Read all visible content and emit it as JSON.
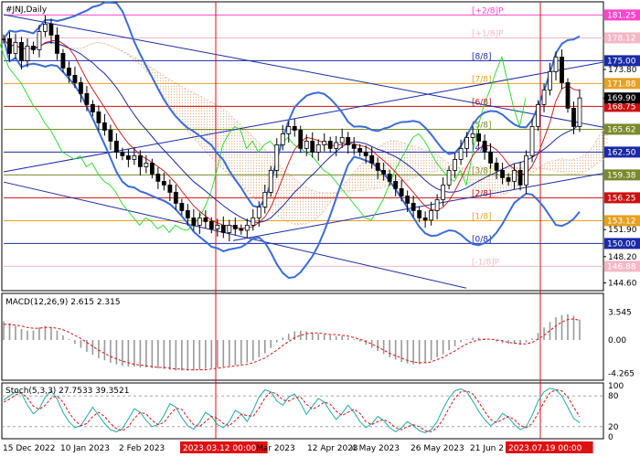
{
  "chart_data": {
    "type": "line",
    "symbol_title": "#JNJ,Daily",
    "x_labels": [
      "15 Dec 2022",
      "10 Jan 2023",
      "2 Feb 2023",
      "2023.03.12 00:00",
      "Mar 2023",
      "12 Apr 2023",
      "4 May 2023",
      "26 May 2023",
      "21 Jun 2",
      "2023.07.19 00:00"
    ],
    "price_axis": {
      "ylim": [
        143.8,
        182.8
      ],
      "ticks": [
        "173.80",
        "169.90",
        "165.62",
        "162.50",
        "159.38",
        "156.25",
        "153.12",
        "151.90",
        "150.00",
        "148.20",
        "146.88",
        "144.60"
      ]
    },
    "murrey_levels": [
      {
        "label": "[+2/8]P",
        "value": 181.25,
        "color": "#ff44cc"
      },
      {
        "label": "[+1/8]P",
        "value": 178.12,
        "color": "#f4b8c4"
      },
      {
        "label": "[8/8]",
        "value": 175.0,
        "color": "#1a2aa8"
      },
      {
        "label": "[7/8]",
        "value": 171.88,
        "color": "#e8a020"
      },
      {
        "label": "[6/8]",
        "value": 168.75,
        "color": "#cc1010"
      },
      {
        "label": "[5/8]",
        "value": 165.62,
        "color": "#7a8a2a"
      },
      {
        "label": "[4/8]",
        "value": 162.5,
        "color": "#1a2aa8"
      },
      {
        "label": "[3/8]",
        "value": 159.38,
        "color": "#7a8a2a"
      },
      {
        "label": "[2/8]",
        "value": 156.25,
        "color": "#cc1010"
      },
      {
        "label": "[1/8]",
        "value": 153.12,
        "color": "#e8a020"
      },
      {
        "label": "[0/8]",
        "value": 150.0,
        "color": "#1a2aa8"
      },
      {
        "label": "[-1/8]P",
        "value": 146.88,
        "color": "#f4b8c4"
      }
    ],
    "level_tags": [
      "181.25",
      "178.12",
      "175.00",
      "171.88",
      "168.75",
      "165.62",
      "162.50",
      "159.38",
      "156.25",
      "153.12",
      "150.00",
      "146.88"
    ],
    "last_price": "169.90",
    "price_series": [
      178,
      176,
      177.5,
      175,
      177,
      176.5,
      179,
      180,
      178.5,
      176,
      174,
      173,
      172,
      170.5,
      169,
      168,
      166.5,
      165.5,
      164,
      162.5,
      162,
      161.5,
      162,
      160.5,
      161,
      159.5,
      158.5,
      158,
      157,
      155.5,
      154.5,
      153.5,
      152.5,
      153.5,
      153,
      152,
      152.5,
      151.5,
      152.5,
      152,
      151.8,
      152.5,
      153.5,
      155,
      157,
      160,
      163.5,
      165,
      166,
      165.5,
      163,
      164,
      162.5,
      163.5,
      164,
      163,
      163.8,
      164.5,
      163.5,
      163,
      162.5,
      162,
      161,
      160,
      159.5,
      158.5,
      157.5,
      156.5,
      155.5,
      154.5,
      153.5,
      153.2,
      154.5,
      156,
      158,
      160,
      161.5,
      163,
      164.5,
      165,
      164,
      162.5,
      161,
      160,
      159,
      158.5,
      160,
      158,
      162,
      166,
      169,
      171,
      173.5,
      175.5,
      172,
      168.5,
      166,
      169.9
    ],
    "macd": {
      "label": "MACD(12,26,9) 2.615 2.315",
      "ticks": [
        "3.545",
        "0.00",
        "-4.265"
      ],
      "range": [
        -4.9,
        4.2
      ],
      "histogram": [
        2.4,
        2.1,
        1.8,
        1.4,
        1.2,
        1.2,
        1.6,
        1.8,
        1.6,
        1.2,
        0.6,
        0.1,
        -0.5,
        -1.0,
        -1.5,
        -1.9,
        -2.3,
        -2.6,
        -2.9,
        -3.1,
        -3.3,
        -3.4,
        -3.4,
        -3.5,
        -3.5,
        -3.6,
        -3.6,
        -3.7,
        -3.8,
        -3.9,
        -3.9,
        -3.9,
        -3.9,
        -3.8,
        -3.7,
        -3.6,
        -3.5,
        -3.4,
        -3.3,
        -3.2,
        -3.1,
        -2.9,
        -2.6,
        -2.2,
        -1.7,
        -1.0,
        -0.3,
        0.3,
        0.8,
        1.1,
        1.2,
        1.1,
        0.9,
        0.8,
        0.7,
        0.6,
        0.5,
        0.5,
        0.3,
        0.1,
        -0.2,
        -0.6,
        -1.0,
        -1.4,
        -1.8,
        -2.2,
        -2.5,
        -2.8,
        -3.0,
        -3.1,
        -3.1,
        -2.9,
        -2.6,
        -2.2,
        -1.8,
        -1.3,
        -0.8,
        -0.3,
        0.1,
        0.3,
        0.3,
        0.2,
        0.0,
        -0.2,
        -0.4,
        -0.5,
        -0.5,
        -0.6,
        -0.3,
        0.2,
        0.9,
        1.6,
        2.3,
        2.9,
        3.2,
        3.3,
        3.1,
        2.6
      ],
      "signal": [
        2.0,
        2.0,
        1.9,
        1.8,
        1.6,
        1.5,
        1.5,
        1.6,
        1.6,
        1.5,
        1.3,
        1.0,
        0.6,
        0.2,
        -0.3,
        -0.8,
        -1.3,
        -1.7,
        -2.1,
        -2.4,
        -2.7,
        -2.9,
        -3.1,
        -3.2,
        -3.3,
        -3.4,
        -3.5,
        -3.5,
        -3.6,
        -3.7,
        -3.7,
        -3.8,
        -3.8,
        -3.8,
        -3.8,
        -3.7,
        -3.6,
        -3.5,
        -3.4,
        -3.3,
        -3.2,
        -3.1,
        -2.9,
        -2.6,
        -2.3,
        -1.8,
        -1.3,
        -0.7,
        -0.2,
        0.3,
        0.6,
        0.8,
        0.9,
        0.9,
        0.8,
        0.7,
        0.7,
        0.6,
        0.5,
        0.3,
        0.1,
        -0.2,
        -0.5,
        -0.9,
        -1.3,
        -1.7,
        -2.0,
        -2.3,
        -2.6,
        -2.8,
        -2.9,
        -2.9,
        -2.8,
        -2.5,
        -2.2,
        -1.8,
        -1.4,
        -0.9,
        -0.5,
        -0.2,
        0.0,
        0.1,
        0.1,
        0.0,
        -0.1,
        -0.3,
        -0.4,
        -0.5,
        -0.5,
        -0.3,
        0.1,
        0.6,
        1.2,
        1.8,
        2.3,
        2.6,
        2.7,
        2.5
      ]
    },
    "stoch": {
      "label": "Stoch(5,3,3) 27.7533 39.3521",
      "ticks": [
        "100",
        "80",
        "20",
        "0"
      ],
      "range": [
        0,
        100
      ],
      "main": [
        72,
        80,
        88,
        85,
        62,
        45,
        55,
        78,
        90,
        74,
        48,
        30,
        18,
        22,
        40,
        58,
        42,
        26,
        14,
        10,
        16,
        35,
        55,
        48,
        32,
        20,
        24,
        42,
        65,
        58,
        38,
        22,
        15,
        28,
        48,
        40,
        24,
        18,
        30,
        52,
        45,
        30,
        52,
        78,
        92,
        88,
        70,
        62,
        78,
        84,
        66,
        44,
        60,
        75,
        68,
        50,
        34,
        46,
        62,
        48,
        30,
        18,
        26,
        40,
        32,
        18,
        10,
        18,
        30,
        22,
        12,
        8,
        14,
        30,
        55,
        76,
        90,
        94,
        88,
        70,
        50,
        34,
        22,
        30,
        46,
        38,
        24,
        14,
        20,
        42,
        70,
        88,
        95,
        92,
        80,
        58,
        36,
        27.75
      ],
      "signal": [
        68,
        74,
        82,
        86,
        76,
        60,
        54,
        62,
        76,
        80,
        68,
        48,
        32,
        22,
        26,
        40,
        48,
        40,
        26,
        16,
        12,
        20,
        36,
        48,
        45,
        32,
        24,
        28,
        44,
        56,
        54,
        38,
        24,
        20,
        30,
        40,
        36,
        26,
        22,
        32,
        44,
        42,
        40,
        56,
        76,
        88,
        84,
        72,
        70,
        76,
        78,
        64,
        54,
        60,
        68,
        64,
        50,
        42,
        48,
        54,
        46,
        30,
        24,
        30,
        34,
        28,
        18,
        14,
        20,
        24,
        20,
        12,
        10,
        18,
        34,
        56,
        76,
        88,
        90,
        84,
        68,
        50,
        34,
        28,
        34,
        40,
        34,
        22,
        18,
        26,
        46,
        68,
        86,
        92,
        90,
        78,
        58,
        39.35
      ]
    },
    "grid": false,
    "legend": "top-left",
    "colors": {
      "background": "#ffffff",
      "bollinger": "#3a6cd8",
      "ichimoku_cloud": "#e8b894",
      "chikou": "#22dd22",
      "regression": "#1a2aa8",
      "macd_hist": "#999999",
      "macd_signal": "#dd1111",
      "stoch_main": "#22aaaa",
      "stoch_signal": "#dd1111",
      "marker_date": "#dd1111"
    }
  }
}
